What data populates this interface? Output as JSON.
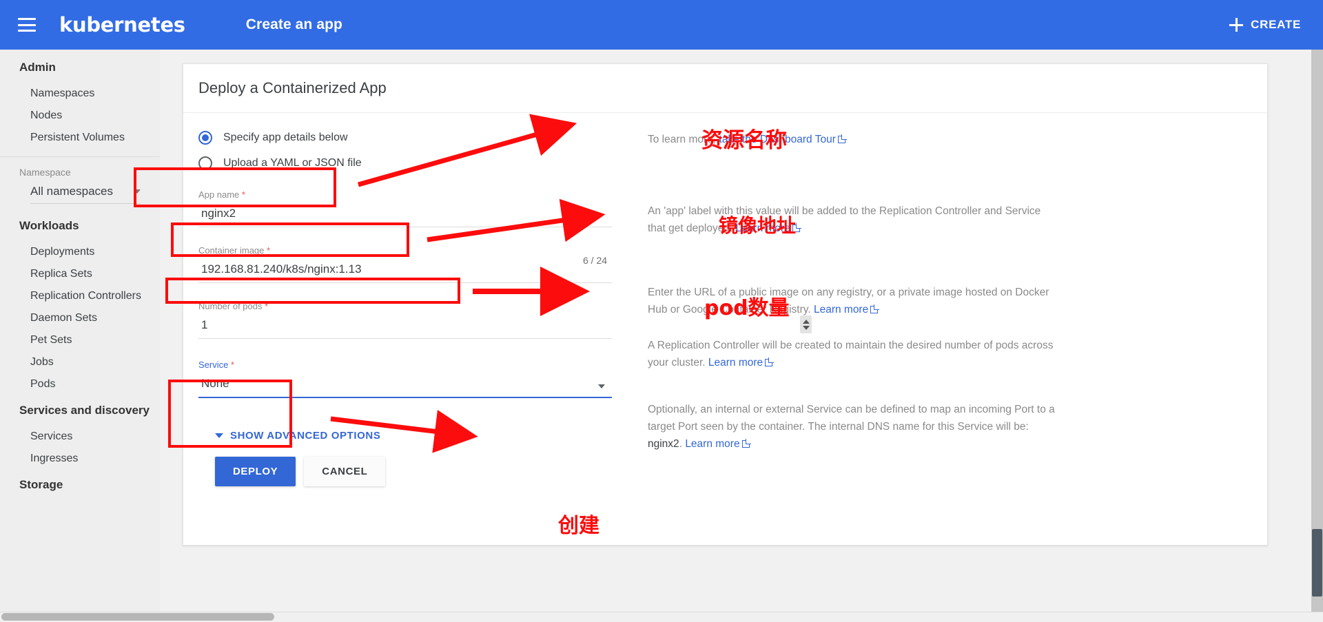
{
  "topbar": {
    "brand": "kubernetes",
    "page_title": "Create an app",
    "create_label": "CREATE",
    "accent_color": "#326ce5"
  },
  "sidebar": {
    "groups": [
      {
        "header": "Admin",
        "items": [
          "Namespaces",
          "Nodes",
          "Persistent Volumes"
        ]
      },
      {
        "header": "Workloads",
        "items": [
          "Deployments",
          "Replica Sets",
          "Replication Controllers",
          "Daemon Sets",
          "Pet Sets",
          "Jobs",
          "Pods"
        ]
      },
      {
        "header": "Services and discovery",
        "items": [
          "Services",
          "Ingresses"
        ]
      },
      {
        "header": "Storage",
        "items": []
      }
    ],
    "namespace": {
      "label": "Namespace",
      "selected": "All namespaces"
    }
  },
  "card": {
    "title": "Deploy a Containerized App",
    "radios": [
      {
        "label": "Specify app details below",
        "checked": true
      },
      {
        "label": "Upload a YAML or JSON file",
        "checked": false
      }
    ],
    "fields": {
      "app_name": {
        "label": "App name",
        "required": true,
        "value": "nginx2",
        "counter": "6 / 24"
      },
      "container_image": {
        "label": "Container image",
        "required": true,
        "value": "192.168.81.240/k8s/nginx:1.13"
      },
      "number_of_pods": {
        "label": "Number of pods",
        "required": true,
        "value": "1"
      },
      "service": {
        "label": "Service",
        "required": true,
        "value": "None"
      }
    },
    "advanced_label": "SHOW ADVANCED OPTIONS",
    "deploy_label": "DEPLOY",
    "cancel_label": "CANCEL"
  },
  "help": {
    "tour_prefix": "To learn more, ",
    "tour_link": "take the Dashboard Tour",
    "app_name_text": "An 'app' label with this value will be added to the Replication Controller and Service that get deployed. ",
    "app_name_link": "Learn more",
    "image_text": "Enter the URL of a public image on any registry, or a private image hosted on Docker Hub or Google Container Registry. ",
    "image_link": "Learn more",
    "pods_text": "A Replication Controller will be created to maintain the desired number of pods across your cluster. ",
    "pods_link": "Learn more",
    "service_text_1": "Optionally, an internal or external Service can be defined to map an incoming Port to a target Port seen by the container. The internal DNS name for this Service will be: ",
    "service_dns": "nginx2",
    "service_text_2": ". ",
    "service_link": "Learn more"
  },
  "annotations": {
    "color": "#fc0c0c",
    "labels": [
      {
        "text": "资源名称",
        "target": "app-name-field"
      },
      {
        "text": "镜像地址",
        "target": "container-image-field"
      },
      {
        "text": "pod数量",
        "target": "number-of-pods-field"
      },
      {
        "text": "创建",
        "target": "deploy-button"
      }
    ]
  }
}
